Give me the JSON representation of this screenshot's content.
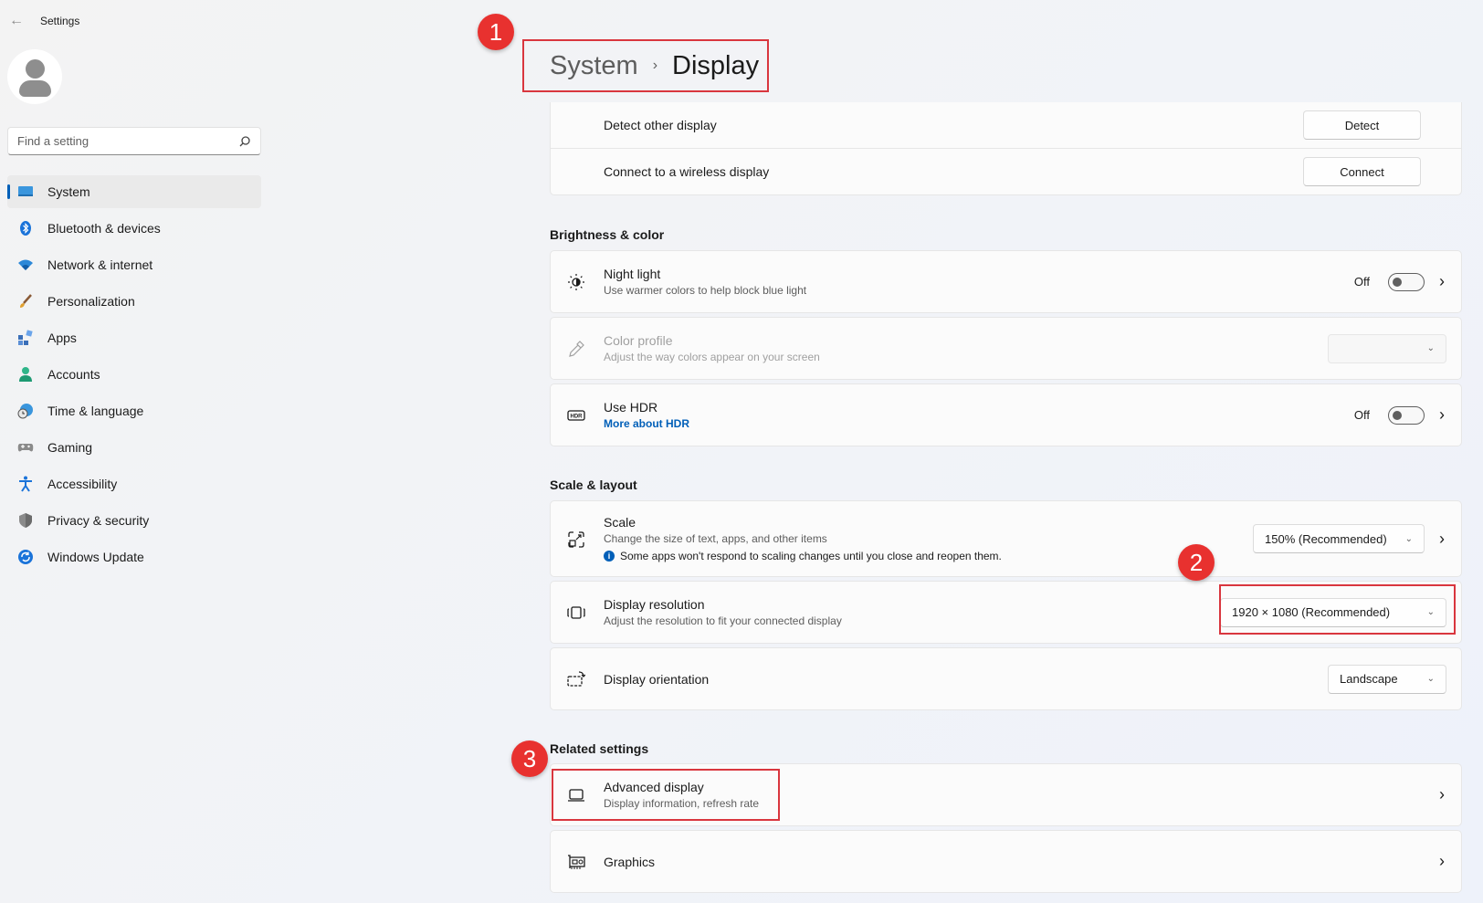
{
  "window": {
    "title": "Settings"
  },
  "search": {
    "placeholder": "Find a setting"
  },
  "sidebar": {
    "items": [
      {
        "label": "System",
        "icon": "monitor-icon",
        "active": true
      },
      {
        "label": "Bluetooth & devices",
        "icon": "bluetooth-icon"
      },
      {
        "label": "Network & internet",
        "icon": "wifi-icon"
      },
      {
        "label": "Personalization",
        "icon": "brush-icon"
      },
      {
        "label": "Apps",
        "icon": "apps-icon"
      },
      {
        "label": "Accounts",
        "icon": "person-icon"
      },
      {
        "label": "Time & language",
        "icon": "globe-clock-icon"
      },
      {
        "label": "Gaming",
        "icon": "gamepad-icon"
      },
      {
        "label": "Accessibility",
        "icon": "accessibility-icon"
      },
      {
        "label": "Privacy & security",
        "icon": "shield-icon"
      },
      {
        "label": "Windows Update",
        "icon": "update-icon"
      }
    ]
  },
  "breadcrumb": {
    "parent": "System",
    "separator": "›",
    "current": "Display"
  },
  "multiple_displays": {
    "detect": {
      "label": "Detect other display",
      "button": "Detect"
    },
    "connect": {
      "label": "Connect to a wireless display",
      "button": "Connect"
    }
  },
  "brightness": {
    "header": "Brightness & color",
    "night_light": {
      "title": "Night light",
      "subtitle": "Use warmer colors to help block blue light",
      "state": "Off"
    },
    "color_profile": {
      "title": "Color profile",
      "subtitle": "Adjust the way colors appear on your screen"
    },
    "hdr": {
      "title": "Use HDR",
      "link": "More about HDR",
      "state": "Off"
    }
  },
  "scale_layout": {
    "header": "Scale & layout",
    "scale": {
      "title": "Scale",
      "subtitle": "Change the size of text, apps, and other items",
      "note": "Some apps won't respond to scaling changes until you close and reopen them.",
      "value": "150% (Recommended)"
    },
    "resolution": {
      "title": "Display resolution",
      "subtitle": "Adjust the resolution to fit your connected display",
      "value": "1920 × 1080 (Recommended)"
    },
    "orientation": {
      "title": "Display orientation",
      "value": "Landscape"
    }
  },
  "related": {
    "header": "Related settings",
    "advanced": {
      "title": "Advanced display",
      "subtitle": "Display information, refresh rate"
    },
    "graphics": {
      "title": "Graphics"
    }
  },
  "annotations": {
    "badge1": "1",
    "badge2": "2",
    "badge3": "3"
  },
  "colors": {
    "accent": "#005fb8",
    "annotation": "#d9363e"
  }
}
